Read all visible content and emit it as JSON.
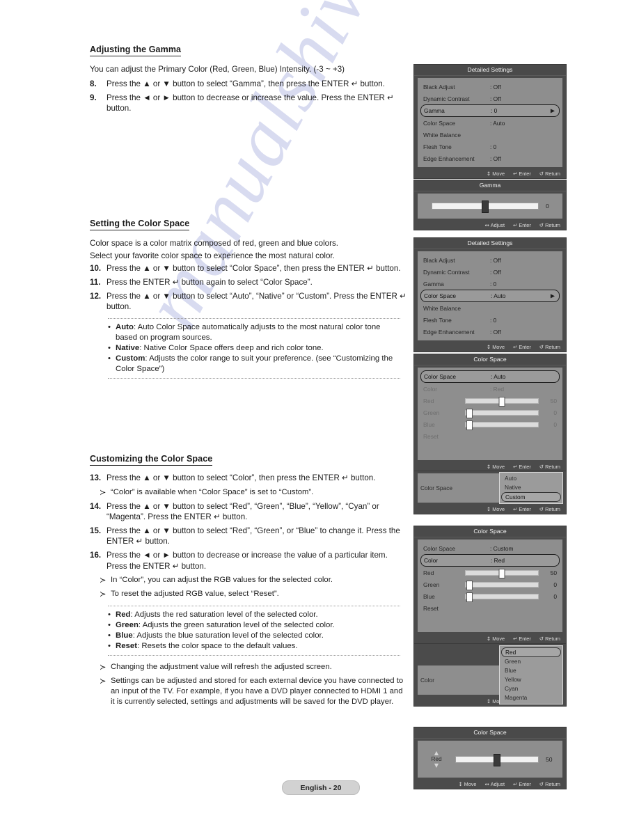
{
  "document": {
    "footer_label": "English - 20",
    "watermark": "manualshive"
  },
  "sections": [
    {
      "id": "gamma",
      "heading": "Adjusting the Gamma",
      "intro": "You can adjust the Primary Color (Red, Green, Blue) Intensity. (-3 ~ +3)",
      "steps": [
        {
          "num": "8.",
          "text": "Press the ▲ or ▼ button to select “Gamma”, then press the ENTER ↵ button."
        },
        {
          "num": "9.",
          "text": "Press the ◄ or ► button to decrease or increase the value. Press the ENTER ↵ button."
        }
      ]
    },
    {
      "id": "color-space",
      "heading": "Setting the Color Space",
      "intro_line1": "Color space is a color matrix composed of red, green and blue colors.",
      "intro_line2": "Select your favorite color space to experience the most natural color.",
      "steps": [
        {
          "num": "10.",
          "text": "Press the ▲ or ▼ button to select “Color Space”, then press the ENTER ↵ button."
        },
        {
          "num": "11.",
          "text": "Press the ENTER ↵ button again to select “Color Space”."
        },
        {
          "num": "12.",
          "text": "Press the ▲ or ▼ button to select “Auto”, “Native” or “Custom”. Press the ENTER ↵ button."
        }
      ],
      "bullets": [
        {
          "term": "Auto",
          "desc": ": Auto Color Space automatically adjusts to the most natural color tone based on program sources."
        },
        {
          "term": "Native",
          "desc": ": Native Color Space offers deep and rich color tone."
        },
        {
          "term": "Custom",
          "desc": ": Adjusts the color range to suit your preference. (see “Customizing the Color Space”)"
        }
      ]
    },
    {
      "id": "customizing",
      "heading": "Customizing the Color Space",
      "steps": [
        {
          "num": "13.",
          "text": "Press the ▲ or ▼ button to select “Color”, then press the ENTER ↵ button."
        },
        {
          "num": "14.",
          "text": "Press the ▲ or ▼ button to select “Red”, “Green”, “Blue”, “Yellow”, “Cyan” or “Magenta”. Press the ENTER ↵ button."
        },
        {
          "num": "15.",
          "text": "Press the ▲ or ▼ button to select “Red”, “Green”, or “Blue” to change it. Press the ENTER ↵ button."
        },
        {
          "num": "16.",
          "text": "Press the ◄ or ► button to decrease or increase the value of a particular item. Press the ENTER ↵ button."
        }
      ],
      "note_after_13": "“Color” is available when “Color Space” is set to “Custom”.",
      "notes_after_16": [
        "In “Color”, you can adjust the RGB values for the selected color.",
        "To reset the adjusted RGB value, select “Reset”."
      ],
      "bullets": [
        {
          "term": "Red",
          "desc": ": Adjusts the red saturation level of the selected color."
        },
        {
          "term": "Green",
          "desc": ": Adjusts the green saturation level of the selected color."
        },
        {
          "term": "Blue",
          "desc": ": Adjusts the blue saturation level of the selected color."
        },
        {
          "term": "Reset",
          "desc": ": Resets the color space to the default values."
        }
      ],
      "tail_notes": [
        "Changing the adjustment value will refresh the adjusted screen.",
        "Settings can be adjusted and stored for each external device you have connected to an input of the TV. For example, if you have a DVD player connected to HDMI 1 and it is currently selected, settings and adjustments will be saved for the DVD player."
      ]
    }
  ],
  "osd_hints": {
    "move": "Move",
    "adjust": "Adjust",
    "enter": "Enter",
    "return": "Return",
    "move_icon": "↕",
    "adjust_icon": "↔",
    "enter_icon": "↵",
    "return_icon": "↺"
  },
  "panels": {
    "detailed_settings_gamma": {
      "title": "Detailed Settings",
      "rows": [
        {
          "label": "Black Adjust",
          "value": ": Off",
          "selected": false
        },
        {
          "label": "Dynamic Contrast",
          "value": ": Off",
          "selected": false
        },
        {
          "label": "Gamma",
          "value": ": 0",
          "selected": true,
          "caret": "▶"
        },
        {
          "label": "Color Space",
          "value": ": Auto",
          "selected": false
        },
        {
          "label": "White Balance",
          "value": "",
          "selected": false
        },
        {
          "label": "Flesh Tone",
          "value": ": 0",
          "selected": false
        },
        {
          "label": "Edge Enhancement",
          "value": ": Off",
          "selected": false
        }
      ]
    },
    "gamma_slider": {
      "title": "Gamma",
      "value": "0",
      "knob_percent": 50
    },
    "detailed_settings_colorspace": {
      "title": "Detailed Settings",
      "rows": [
        {
          "label": "Black Adjust",
          "value": ": Off",
          "selected": false
        },
        {
          "label": "Dynamic Contrast",
          "value": ": Off",
          "selected": false
        },
        {
          "label": "Gamma",
          "value": ": 0",
          "selected": false
        },
        {
          "label": "Color Space",
          "value": ": Auto",
          "selected": true,
          "caret": "▶"
        },
        {
          "label": "White Balance",
          "value": "",
          "selected": false
        },
        {
          "label": "Flesh Tone",
          "value": ": 0",
          "selected": false
        },
        {
          "label": "Edge Enhancement",
          "value": ": Off",
          "selected": false
        }
      ]
    },
    "color_space_auto": {
      "title": "Color Space",
      "header_row": {
        "label": "Color Space",
        "value": ": Auto",
        "selected": true
      },
      "color_row": {
        "label": "Color",
        "value": ": Red",
        "dim": true
      },
      "sliders": [
        {
          "label": "Red",
          "value": "50",
          "percent": 50,
          "dim": true
        },
        {
          "label": "Green",
          "value": "0",
          "percent": 0,
          "dim": true
        },
        {
          "label": "Blue",
          "value": "0",
          "percent": 0,
          "dim": true
        }
      ],
      "reset_label": "Reset"
    },
    "color_space_dropdown": {
      "base_label": "Color Space",
      "options": [
        {
          "label": "Auto",
          "selected": false
        },
        {
          "label": "Native",
          "selected": false
        },
        {
          "label": "Custom",
          "selected": true
        }
      ]
    },
    "color_space_custom": {
      "title": "Color Space",
      "header_row": {
        "label": "Color Space",
        "value": ": Custom",
        "selected": false
      },
      "color_row": {
        "label": "Color",
        "value": ": Red",
        "selected": true
      },
      "sliders": [
        {
          "label": "Red",
          "value": "50",
          "percent": 50
        },
        {
          "label": "Green",
          "value": "0",
          "percent": 0
        },
        {
          "label": "Blue",
          "value": "0",
          "percent": 0
        }
      ],
      "reset_label": "Reset"
    },
    "color_dropdown": {
      "base_label": "Color",
      "options": [
        {
          "label": "Red",
          "selected": true
        },
        {
          "label": "Green",
          "selected": false
        },
        {
          "label": "Blue",
          "selected": false
        },
        {
          "label": "Yellow",
          "selected": false
        },
        {
          "label": "Cyan",
          "selected": false
        },
        {
          "label": "Magenta",
          "selected": false
        }
      ]
    },
    "red_slider": {
      "title": "Color Space",
      "label": "Red",
      "value": "50",
      "knob_percent": 50
    }
  }
}
